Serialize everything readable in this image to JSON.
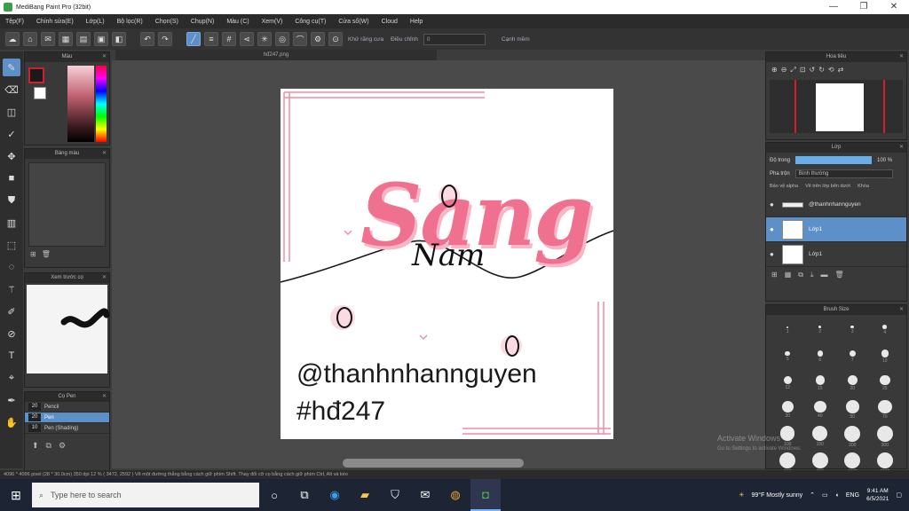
{
  "window": {
    "title": "MediBang Paint Pro (32bit)",
    "controls": [
      "—",
      "❐",
      "✕"
    ]
  },
  "menu": [
    "Tệp(F)",
    "Chỉnh sửa(E)",
    "Lớp(L)",
    "Bộ lọc(R)",
    "Chọn(S)",
    "Chụp(N)",
    "Màu (C)",
    "Xem(V)",
    "Công cụ(T)",
    "Cửa sổ(W)",
    "Cloud",
    "Help"
  ],
  "toolbar": {
    "auto_label": "Khử răng cưa",
    "adjust_label": "Điều chỉnh",
    "adjust_value": "0",
    "edge_label": "Cạnh mềm"
  },
  "doc_tab": "hđ247.png",
  "panels": {
    "color": "Màu",
    "swatch": "Bảng màu",
    "brush_preview": "Xem trước cọ",
    "brush_list": "Cọ Pen",
    "navigator": "Hoa tiêu",
    "layer": "Lớp",
    "brush_size": "Brush Size"
  },
  "brushes": [
    {
      "size": "20",
      "name": "Pencil",
      "selected": false
    },
    {
      "size": "20",
      "name": "Pen",
      "selected": true
    },
    {
      "size": "10",
      "name": "Pen (Shading)",
      "selected": false
    }
  ],
  "layer": {
    "opacity_label": "Độ trong",
    "opacity_value": "100 %",
    "blend_label": "Pha trộn",
    "blend_value": "Bình thường",
    "checks": [
      "Bảo vệ alpha",
      "Vẽ trên lớp bên dưới",
      "Khóa"
    ],
    "items": [
      {
        "name": "@thanhnhannguyen",
        "selected": false
      },
      {
        "name": "Lớp1",
        "selected": true
      },
      {
        "name": "Lớp1",
        "selected": false
      }
    ]
  },
  "brush_sizes": [
    "1",
    "2",
    "3",
    "4",
    "5",
    "6",
    "7",
    "10",
    "12",
    "15",
    "20",
    "25",
    "30",
    "40",
    "50",
    "70",
    "100",
    "150",
    "200",
    "300",
    "500",
    "700",
    "1000",
    "1500"
  ],
  "artwork": {
    "main_word": "Sang",
    "handwriting": "Nam",
    "handle": "@thanhnhannguyen",
    "tag": "#hđ247",
    "accent": "#f0708f"
  },
  "status": "4096 * 4096 pixel (28 * 30.0cm) 350 dpi 12 % ( 3472, 2592 ) Vẽ một đường thẳng bằng cách giữ phím Shift. Thay đổi cỡ cọ bằng cách giữ phím Ctrl, Alt và kéo",
  "watermark": {
    "line1": "Activate Windows",
    "line2": "Go to Settings to activate Windows."
  },
  "taskbar": {
    "search_placeholder": "Type here to search",
    "weather": "99°F  Mostly sunny",
    "lang": "ENG",
    "time": "9:41 AM",
    "date": "6/5/2021"
  }
}
